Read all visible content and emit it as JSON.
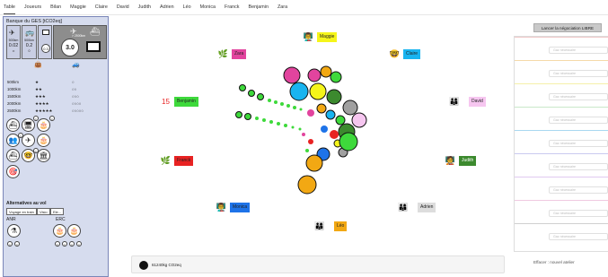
{
  "tabs": [
    "Table",
    "Joueurs",
    "Bilan",
    "Maggie",
    "Claire",
    "David",
    "Judith",
    "Adrien",
    "Léo",
    "Monica",
    "Franck",
    "Benjamin",
    "Zara"
  ],
  "left_panel": {
    "title": "Banque du GES [tCO2eq]",
    "bank": {
      "box1_label": "500km",
      "box1_value": "0.02",
      "box1_sub": "∞",
      "box2_label": "500km",
      "box2_value": "0.2",
      "box2_sub": "0",
      "box3_value": "0.3",
      "selected_label": "> 2500km",
      "selected_value": "3.0"
    },
    "km_rows": [
      {
        "km": "500km",
        "stars": "★",
        "circles": "○"
      },
      {
        "km": "1000km",
        "stars": "★★",
        "circles": "○○"
      },
      {
        "km": "1500km",
        "stars": "★★★",
        "circles": "○○○"
      },
      {
        "km": "2000km",
        "stars": "★★★★",
        "circles": "○○○○"
      },
      {
        "km": "2500km",
        "stars": "★★★★★",
        "circles": "○○○○○"
      }
    ],
    "alternatives_title": "Alternatives au vol",
    "alt_buttons": [
      "Voyage en train",
      "Visio",
      "Ele..."
    ],
    "alt_labels": [
      "ANR",
      "ERC"
    ]
  },
  "players": [
    {
      "name": "Maggie",
      "color": "#f5f51a",
      "icon": "person-icon"
    },
    {
      "name": "Zara",
      "color": "#e2449e",
      "icon": "plant-icon"
    },
    {
      "name": "Claire",
      "color": "#19b4f0",
      "icon": "glasses-icon"
    },
    {
      "name": "Benjamin",
      "color": "#3ed93b",
      "icon": "number-icon"
    },
    {
      "name": "David",
      "color": "#f6c6f0",
      "icon": "group-icon"
    },
    {
      "name": "Franck",
      "color": "#e82222",
      "icon": "plant-icon"
    },
    {
      "name": "Judith",
      "color": "#3c8a2e",
      "icon": "person-icon"
    },
    {
      "name": "Monica",
      "color": "#1e73e8",
      "icon": "person-icon"
    },
    {
      "name": "Adrien",
      "color": "#dddddd",
      "icon": "group-icon"
    },
    {
      "name": "Léo",
      "color": "#f2a813",
      "icon": "group-icon"
    }
  ],
  "footer": {
    "text": "61240kg CO2eq"
  },
  "right": {
    "launch_label": "Lancer la négociation LIBRE",
    "offer_placeholders": [
      "Gaz nécessaire",
      "Gaz nécessaire",
      "Gaz nécessaire",
      "Gaz nécessaire",
      "Gaz nécessaire",
      "Gaz nécessaire",
      "Gaz nécessaire",
      "Gaz nécessaire",
      "Gaz nécessaire"
    ],
    "offer_colors": [
      "#f0c9c9",
      "#f5d9a8",
      "#f5f0a8",
      "#c9e8c9",
      "#a8d8f0",
      "#c9c9f0",
      "#e0c9f0",
      "#f0c9e0",
      "#d0d0d0"
    ],
    "clear_label": "Effacer : nouvel atelier"
  }
}
